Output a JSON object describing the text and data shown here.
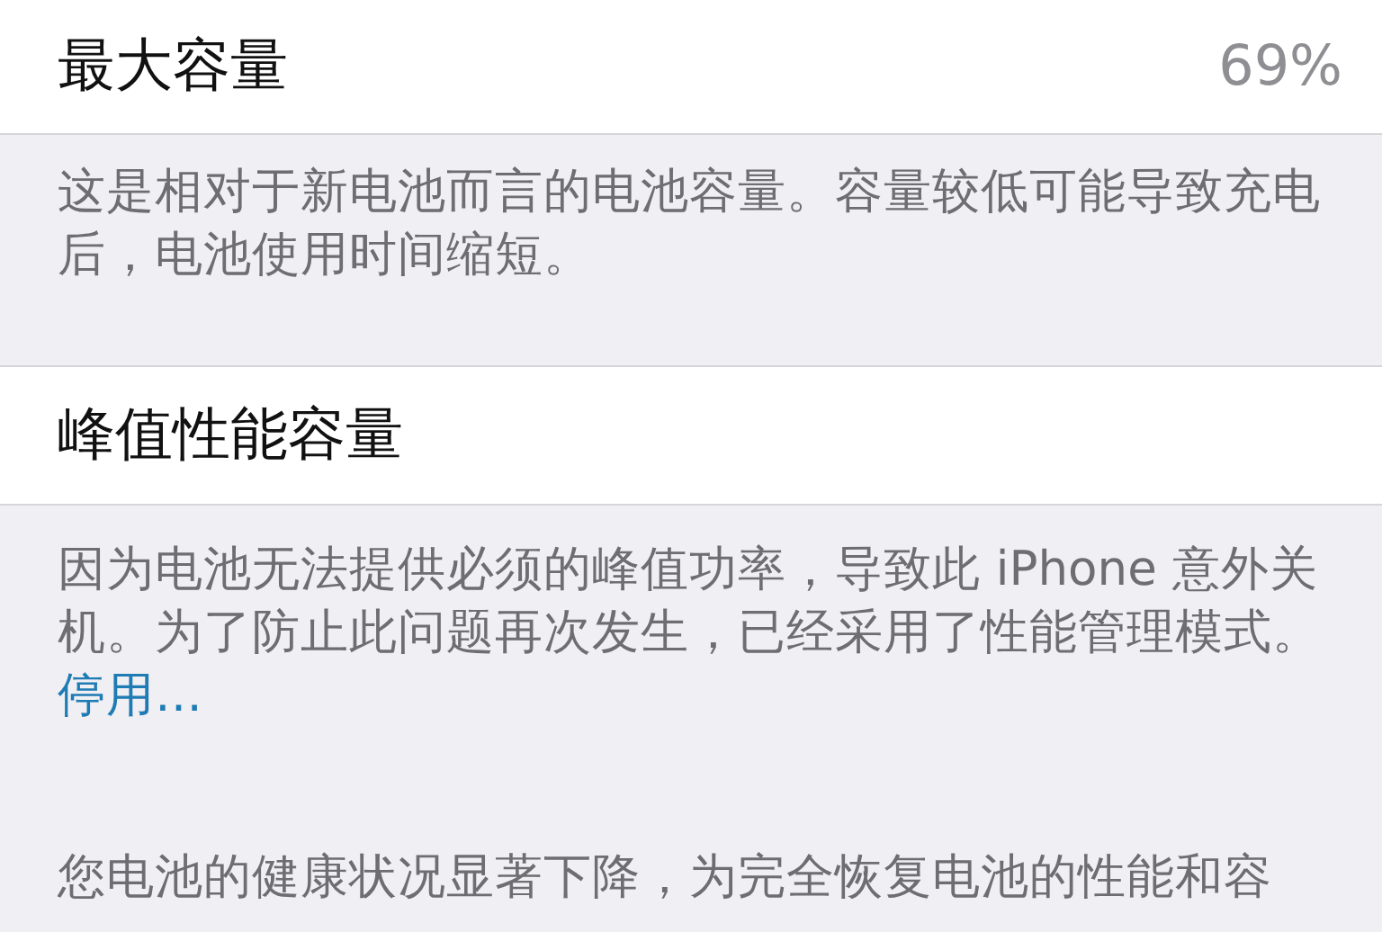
{
  "maximum_capacity": {
    "label": "最大容量",
    "value": "69%",
    "description": "这是相对于新电池而言的电池容量。容量较低可能导致充电后，电池使用时间缩短。"
  },
  "peak_performance": {
    "label": "峰值性能容量",
    "description": "因为电池无法提供必须的峰值功率，导致此 iPhone 意外关机。为了防止此问题再次发生，已经采用了性能管理模式。",
    "link": "停用…"
  },
  "next_description": "您电池的健康状况显著下降，为完全恢复电池的性能和容"
}
